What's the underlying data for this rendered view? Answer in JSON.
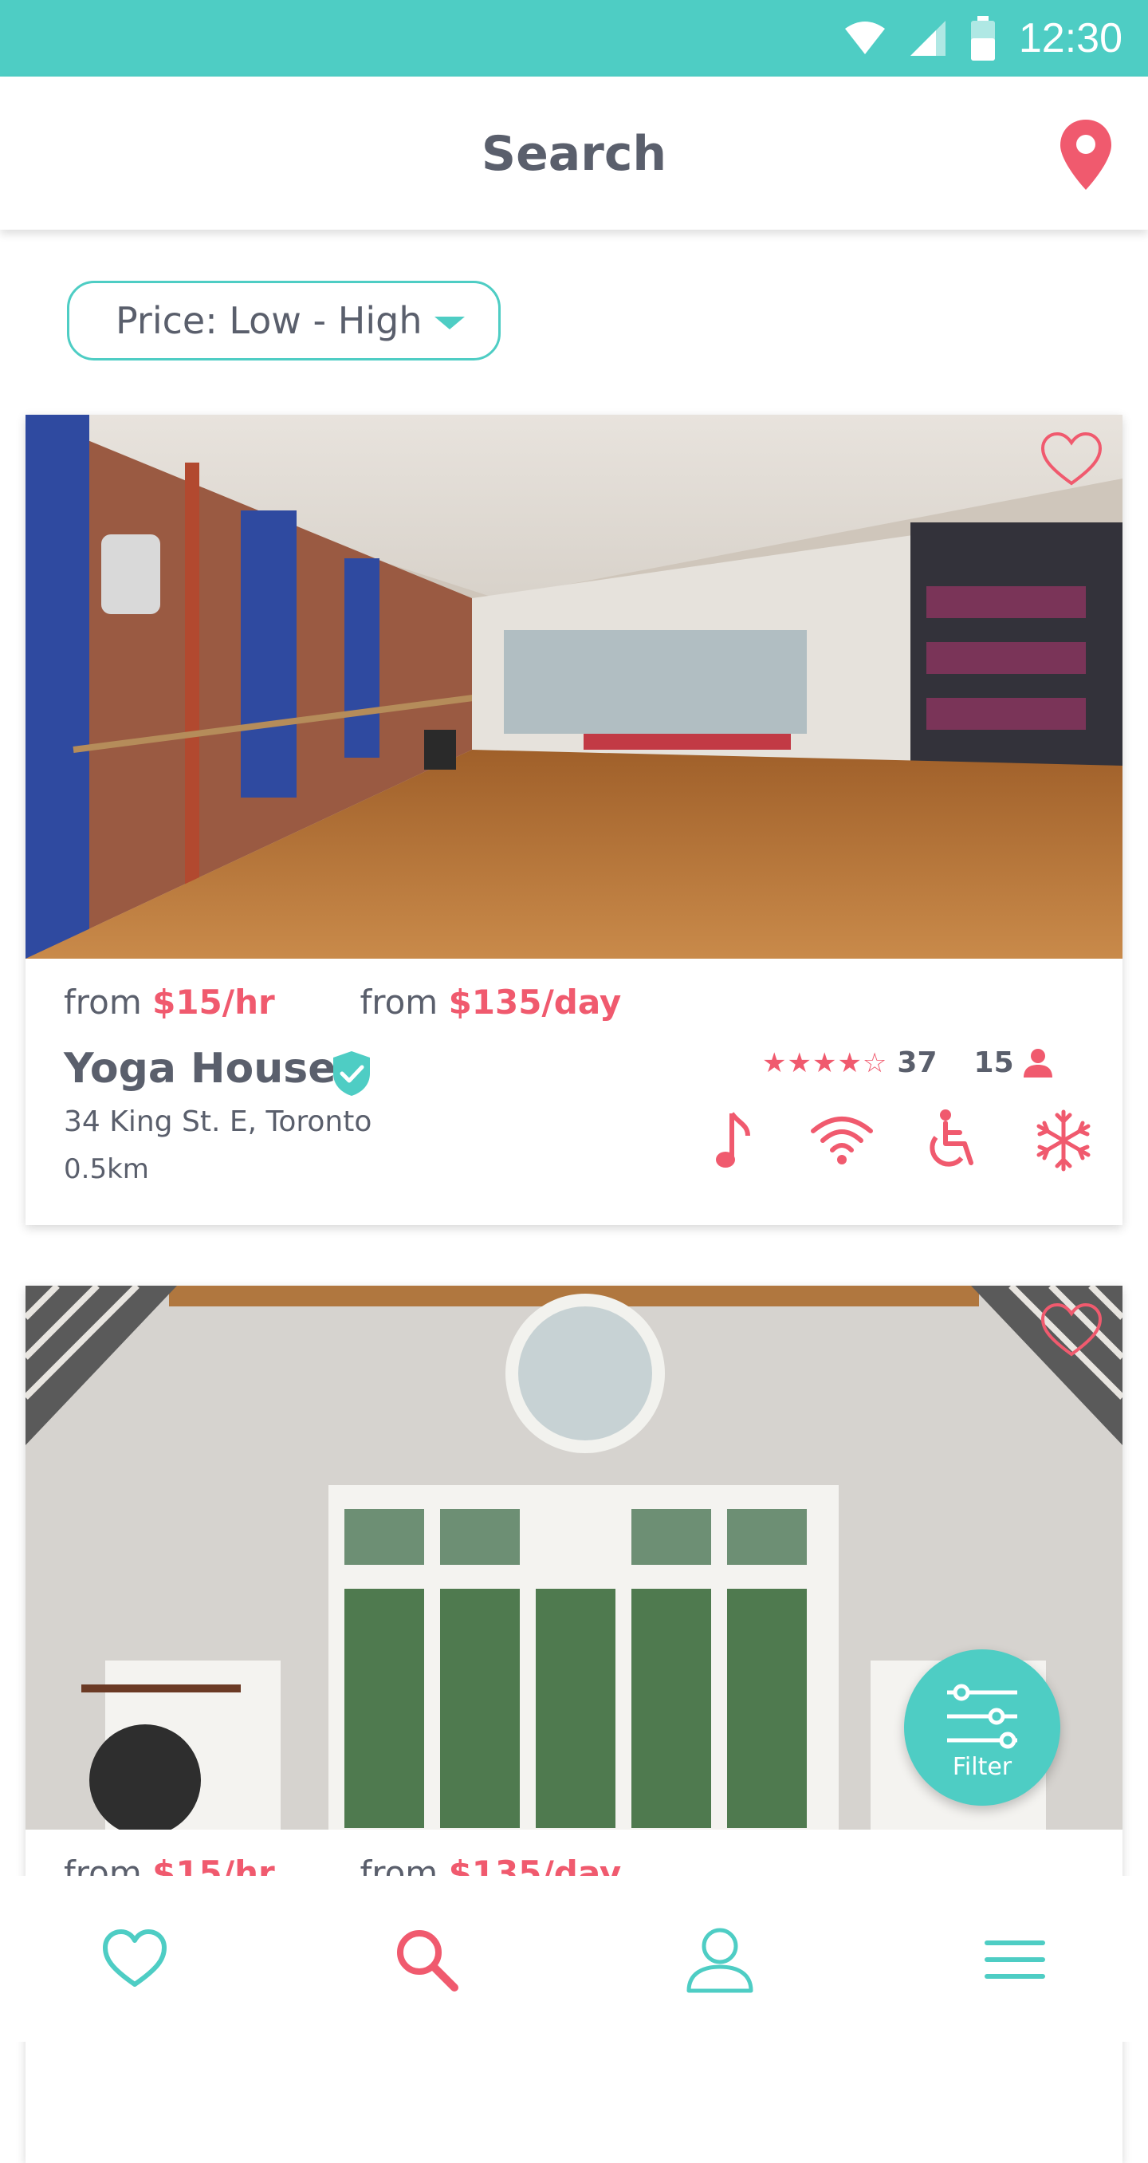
{
  "status_bar": {
    "time": "12:30"
  },
  "header": {
    "title": "Search"
  },
  "sort": {
    "label": "Price: Low - High"
  },
  "listings": [
    {
      "from_label_hourly": "from",
      "price_hourly": "$15/hr",
      "from_label_daily": "from",
      "price_daily": "$135/day",
      "name": "Yoga House",
      "address": "34 King St. E, Toronto",
      "distance": "0.5km",
      "stars": "★★★★☆",
      "rating_count": "37",
      "capacity": "15",
      "amenities": [
        "music-icon",
        "wifi-icon",
        "wheelchair-icon",
        "snowflake-icon"
      ]
    },
    {
      "from_label_hourly": "from",
      "price_hourly": "$15/hr",
      "from_label_daily": "from",
      "price_daily": "$135/day"
    }
  ],
  "fab": {
    "label": "Filter"
  },
  "bottom_nav": [
    "heart-icon",
    "search-icon",
    "profile-icon",
    "menu-icon"
  ],
  "colors": {
    "teal": "#4ecdc4",
    "coral": "#f05a6e",
    "text": "#5a5f6c"
  }
}
